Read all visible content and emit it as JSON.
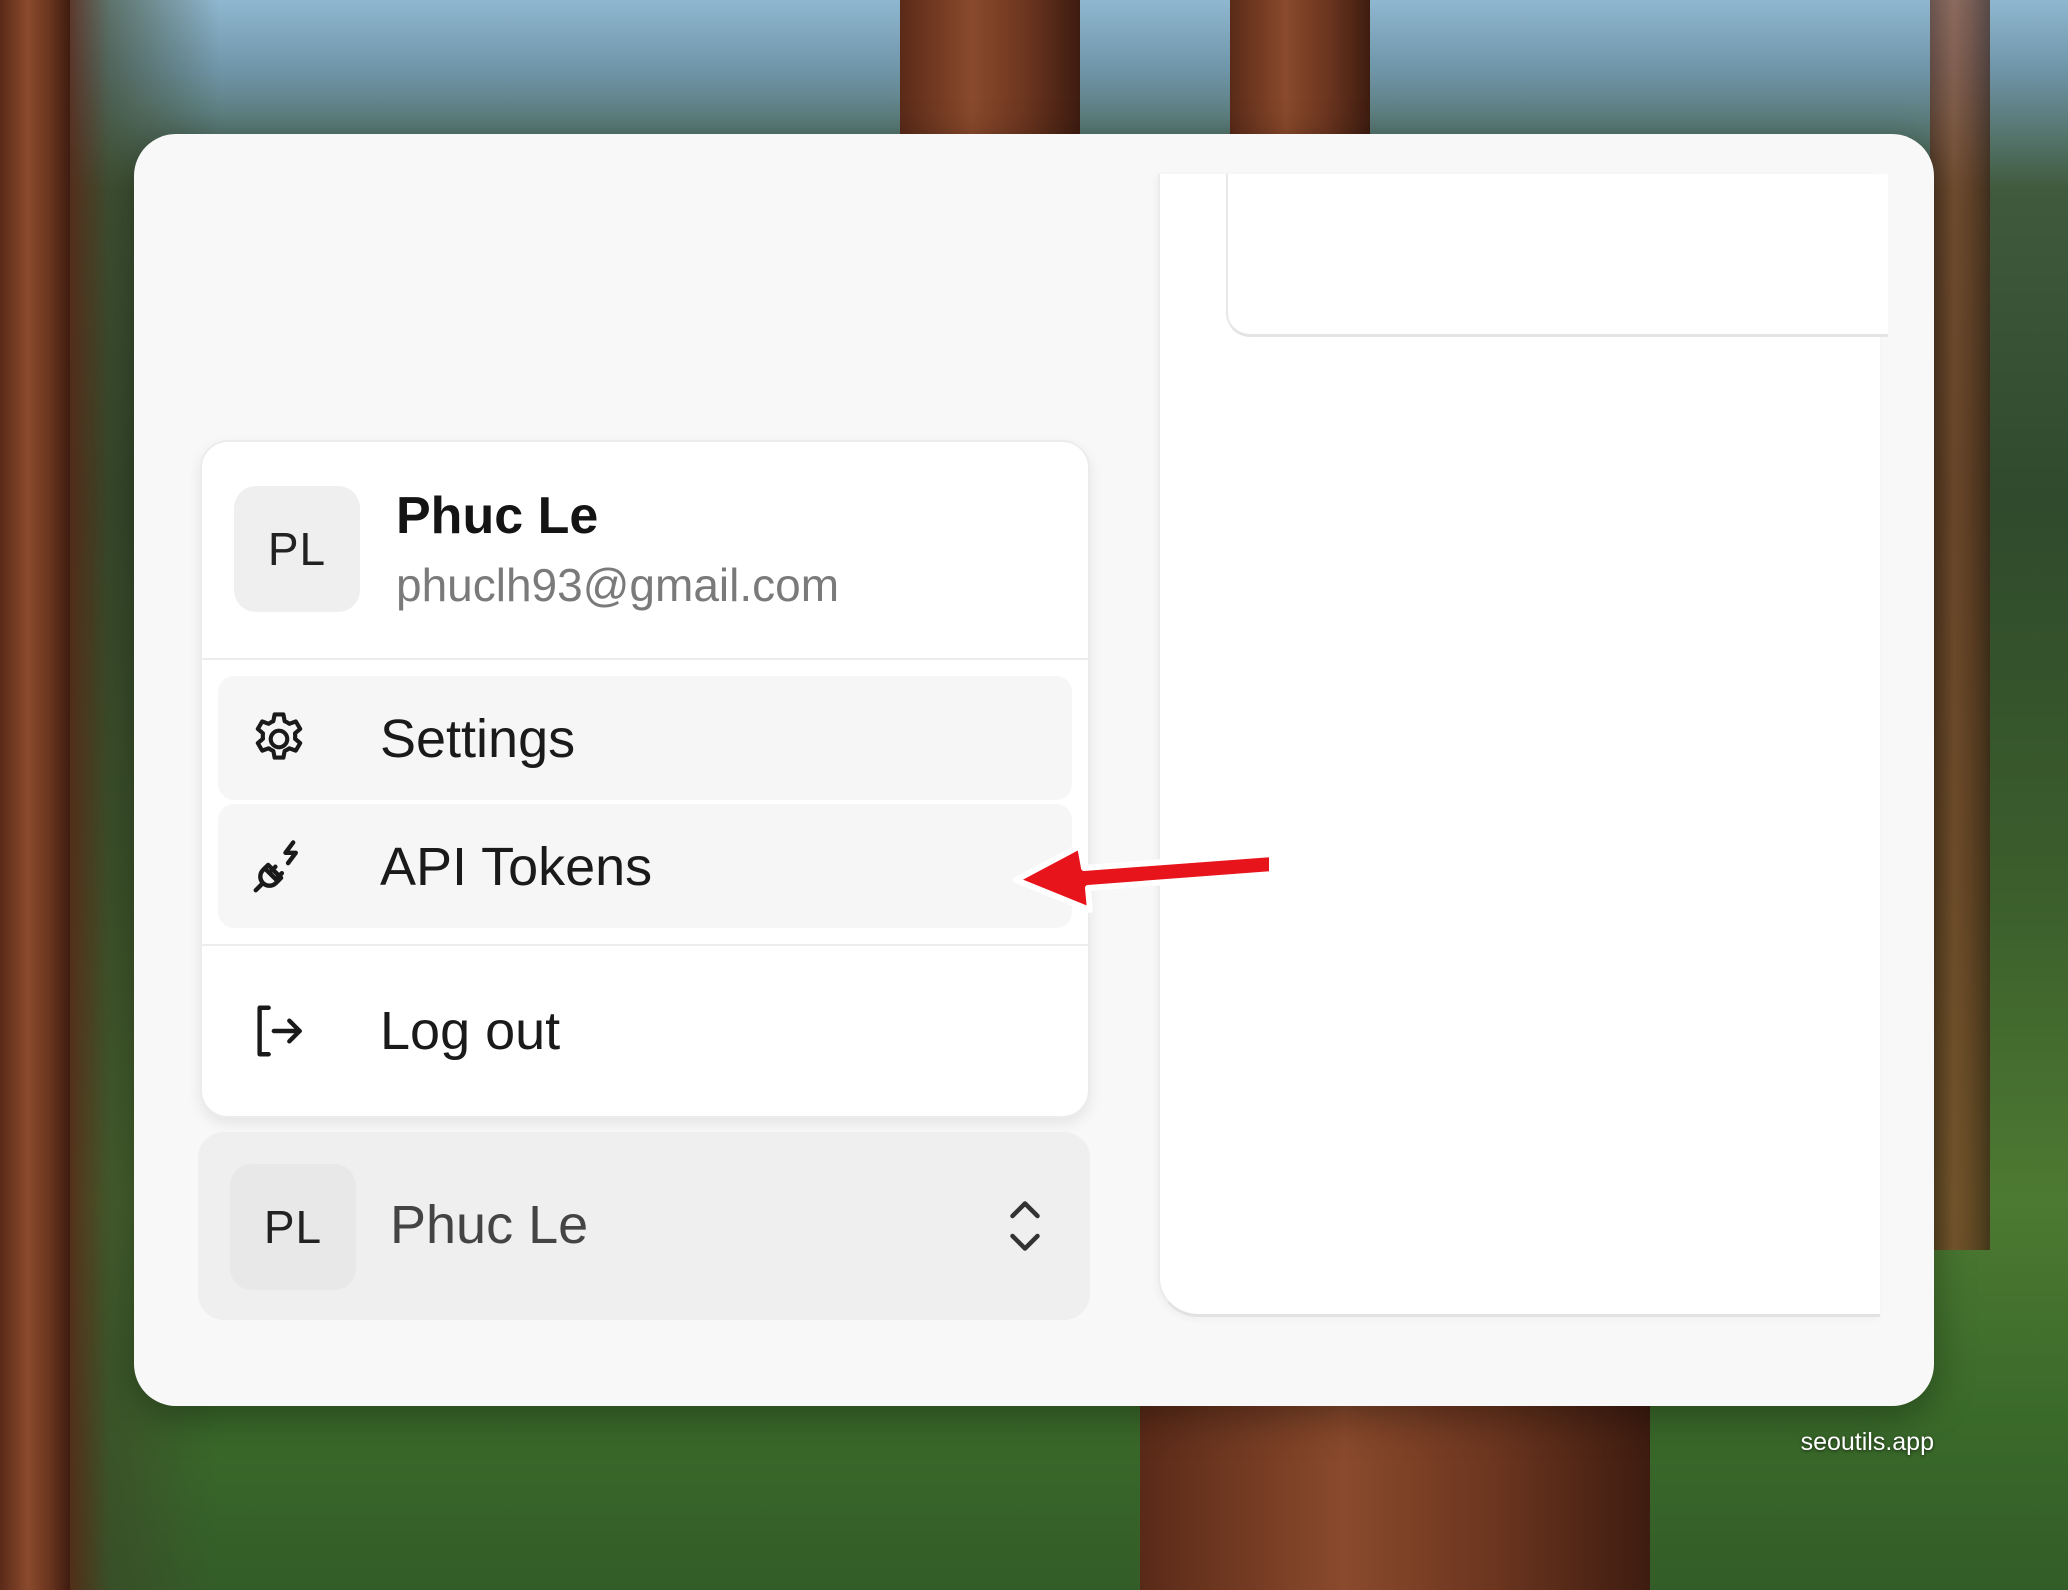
{
  "user": {
    "initials": "PL",
    "name": "Phuc Le",
    "email": "phuclh93@gmail.com"
  },
  "menu": {
    "items": [
      {
        "label": "Settings",
        "icon": "gear-icon"
      },
      {
        "label": "API Tokens",
        "icon": "plug-icon"
      }
    ],
    "logout": {
      "label": "Log out",
      "icon": "logout-icon"
    }
  },
  "switcher": {
    "initials": "PL",
    "name": "Phuc Le",
    "icon": "chevron-up-down-icon"
  },
  "annotation": {
    "arrow_color": "#e8141b"
  },
  "watermark": "seoutils.app"
}
